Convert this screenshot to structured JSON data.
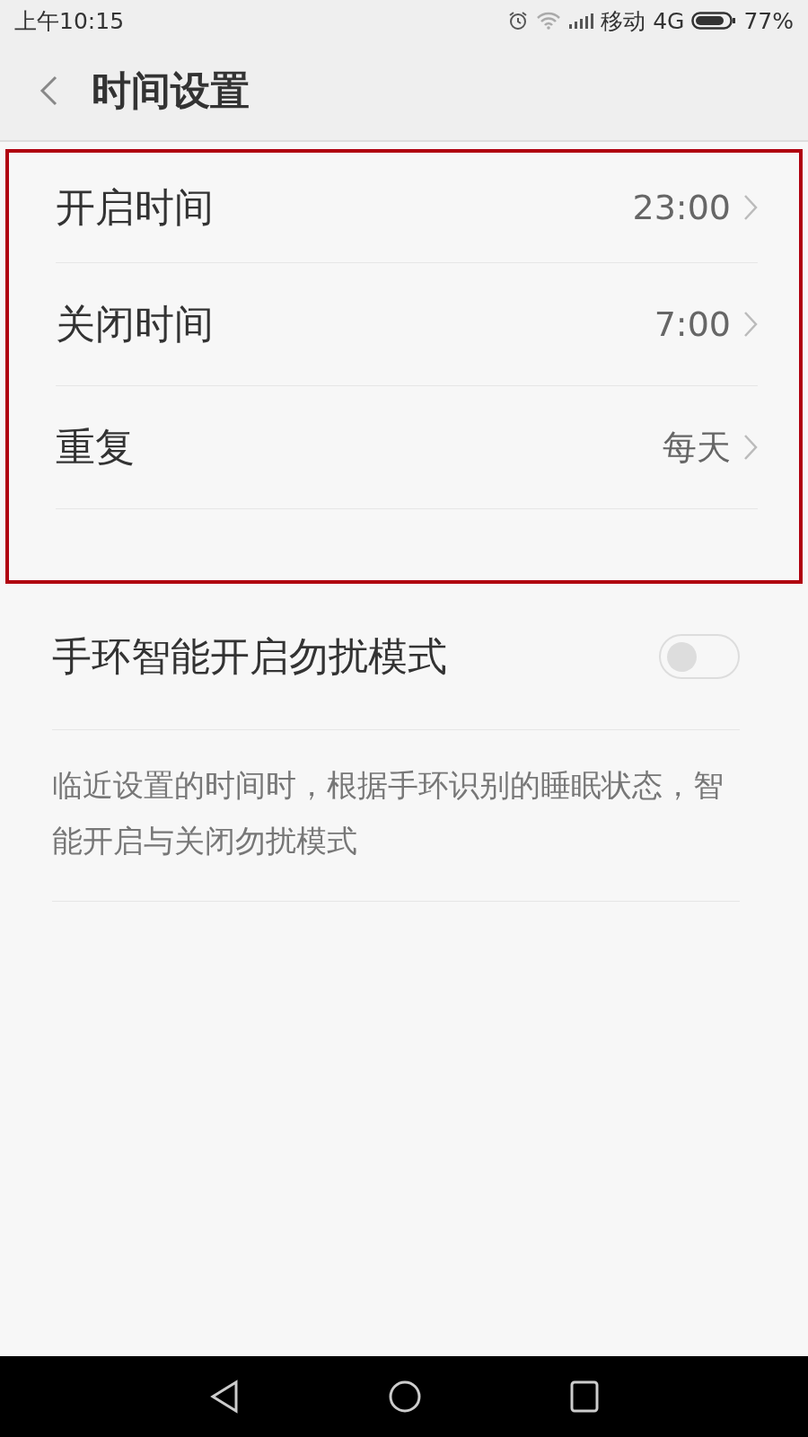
{
  "status_bar": {
    "time": "上午10:15",
    "carrier": "移动 4G",
    "battery": "77%"
  },
  "header": {
    "title": "时间设置"
  },
  "time_rows": [
    {
      "label": "开启时间",
      "value": "23:00"
    },
    {
      "label": "关闭时间",
      "value": "7:00"
    },
    {
      "label": "重复",
      "value": "每天"
    }
  ],
  "smart_toggle": {
    "label": "手环智能开启勿扰模式",
    "on": false
  },
  "description": "临近设置的时间时，根据手环识别的睡眠状态，智能开启与关闭勿扰模式"
}
